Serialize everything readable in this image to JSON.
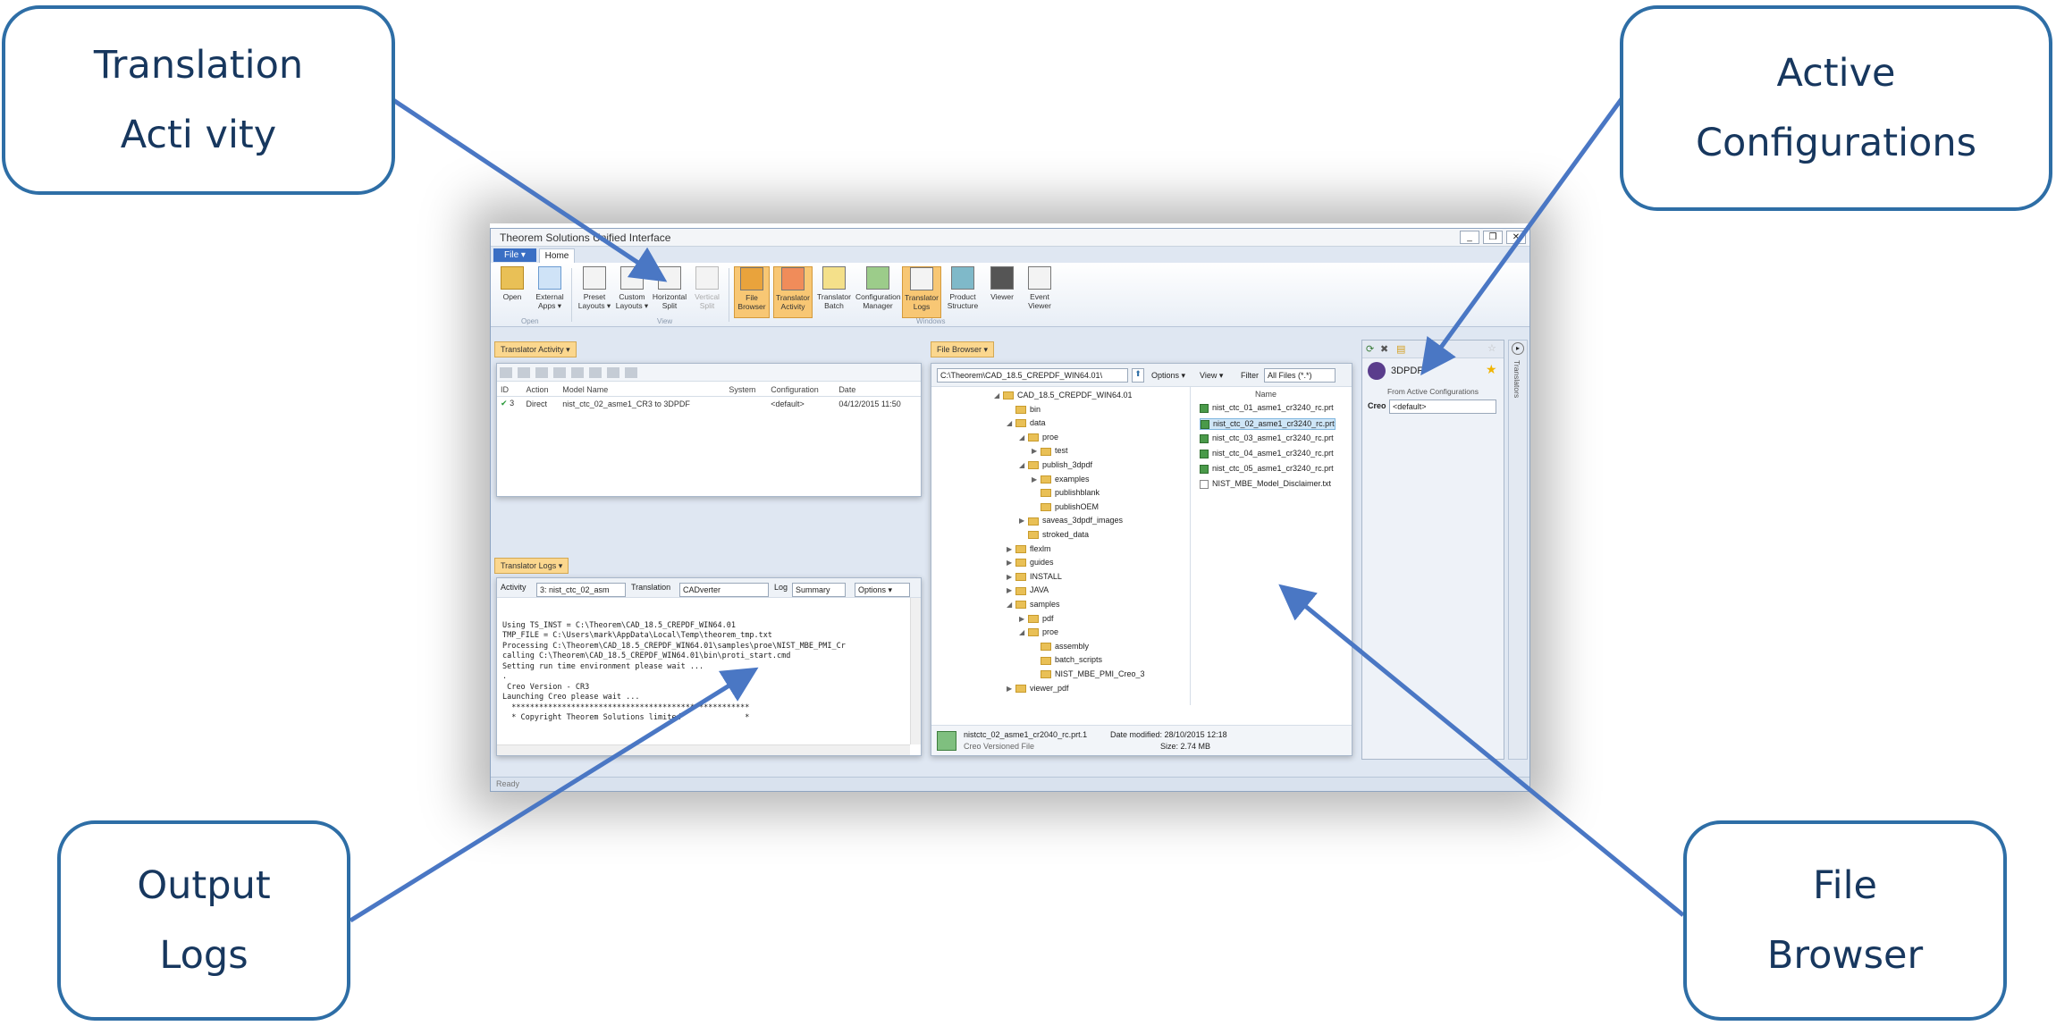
{
  "callouts": {
    "translation": [
      "Translation",
      "Acti vity"
    ],
    "active": [
      "Active",
      "Configurations"
    ],
    "output": [
      "Output",
      "Logs"
    ],
    "file_browser": [
      "File",
      "Browser"
    ]
  },
  "window": {
    "title": "Theorem Solutions Unified Interface",
    "controls": [
      "_",
      "❐",
      "✕"
    ],
    "file_tab": "File ▾",
    "home_tab": "Home"
  },
  "ribbon": {
    "buttons": [
      {
        "label": "Open",
        "icon": "folder-open-icon"
      },
      {
        "label": "External Apps ▾",
        "icon": "external-apps-icon"
      },
      {
        "label": "Preset Layouts ▾",
        "icon": "preset-layout-icon"
      },
      {
        "label": "Custom Layouts ▾",
        "icon": "custom-layout-icon"
      },
      {
        "label": "Horizontal Split",
        "icon": "horizontal-split-icon"
      },
      {
        "label": "Vertical Split",
        "icon": "vertical-split-icon"
      },
      {
        "label": "File Browser",
        "icon": "file-browser-icon"
      },
      {
        "label": "Translator Activity",
        "icon": "translator-activity-icon"
      },
      {
        "label": "Translator Batch",
        "icon": "translator-batch-icon"
      },
      {
        "label": "Configuration Manager",
        "icon": "configuration-manager-icon"
      },
      {
        "label": "Translator Logs",
        "icon": "translator-logs-icon"
      },
      {
        "label": "Product Structure",
        "icon": "product-structure-icon"
      },
      {
        "label": "Viewer",
        "icon": "viewer-icon"
      },
      {
        "label": "Event Viewer",
        "icon": "event-viewer-icon"
      }
    ],
    "groups": [
      "Open",
      "View",
      "Windows"
    ]
  },
  "translator_activity": {
    "tab": "Translator Activity ▾",
    "columns": [
      "ID",
      "Action",
      "Model Name",
      "System",
      "Configuration",
      "Date"
    ],
    "rows": [
      {
        "id": "3",
        "action": "Direct",
        "model": "nist_ctc_02_asme1_CR3 to 3DPDF",
        "system": "",
        "configuration": "<default>",
        "date": "04/12/2015 11:50"
      }
    ]
  },
  "translator_logs": {
    "tab": "Translator Logs ▾",
    "activity_label": "Activity",
    "activity_value": "3: nist_ctc_02_asm",
    "translation_label": "Translation",
    "translation_value": "CADverter",
    "log_label": "Log",
    "log_value": "Summary",
    "options_label": "Options ▾",
    "lines": [
      "Using TS_INST = C:\\Theorem\\CAD_18.5_CREPDF_WIN64.01",
      "TMP_FILE = C:\\Users\\mark\\AppData\\Local\\Temp\\theorem_tmp.txt",
      "Processing C:\\Theorem\\CAD_18.5_CREPDF_WIN64.01\\samples\\proe\\NIST_MBE_PMI_Cr",
      "calling C:\\Theorem\\CAD_18.5_CREPDF_WIN64.01\\bin\\proti_start.cmd",
      "Setting run time environment please wait ...",
      ".",
      " Creo Version - CR3",
      "Launching Creo please wait ...",
      "",
      "  ****************************************************",
      "  * Copyright Theorem Solutions limited              *"
    ]
  },
  "file_browser": {
    "tab": "File Browser ▾",
    "path": "C:\\Theorem\\CAD_18.5_CREPDF_WIN64.01\\",
    "options_label": "Options ▾",
    "view_label": "View ▾",
    "filter_label": "Filter",
    "filter_value": "All Files (*.*)",
    "name_column": "Name",
    "tree": [
      {
        "label": "CAD_18.5_CREPDF_WIN64.01",
        "depth": 0,
        "exp": "◢"
      },
      {
        "label": "bin",
        "depth": 1,
        "exp": ""
      },
      {
        "label": "data",
        "depth": 1,
        "exp": "◢"
      },
      {
        "label": "proe",
        "depth": 2,
        "exp": "◢"
      },
      {
        "label": "test",
        "depth": 3,
        "exp": "▶"
      },
      {
        "label": "publish_3dpdf",
        "depth": 2,
        "exp": "◢"
      },
      {
        "label": "examples",
        "depth": 3,
        "exp": "▶"
      },
      {
        "label": "publishblank",
        "depth": 3,
        "exp": ""
      },
      {
        "label": "publishOEM",
        "depth": 3,
        "exp": ""
      },
      {
        "label": "saveas_3dpdf_images",
        "depth": 2,
        "exp": "▶"
      },
      {
        "label": "stroked_data",
        "depth": 2,
        "exp": ""
      },
      {
        "label": "flexlm",
        "depth": 1,
        "exp": "▶"
      },
      {
        "label": "guides",
        "depth": 1,
        "exp": "▶"
      },
      {
        "label": "INSTALL",
        "depth": 1,
        "exp": "▶"
      },
      {
        "label": "JAVA",
        "depth": 1,
        "exp": "▶"
      },
      {
        "label": "samples",
        "depth": 1,
        "exp": "◢"
      },
      {
        "label": "pdf",
        "depth": 2,
        "exp": "▶"
      },
      {
        "label": "proe",
        "depth": 2,
        "exp": "◢"
      },
      {
        "label": "assembly",
        "depth": 3,
        "exp": ""
      },
      {
        "label": "batch_scripts",
        "depth": 3,
        "exp": ""
      },
      {
        "label": "NIST_MBE_PMI_Creo_3",
        "depth": 3,
        "exp": ""
      },
      {
        "label": "viewer_pdf",
        "depth": 1,
        "exp": "▶"
      }
    ],
    "files": [
      "nist_ctc_01_asme1_cr3240_rc.prt",
      "nist_ctc_02_asme1_cr3240_rc.prt",
      "nist_ctc_03_asme1_cr3240_rc.prt",
      "nist_ctc_04_asme1_cr3240_rc.prt",
      "nist_ctc_05_asme1_cr3240_rc.prt",
      "NIST_MBE_Model_Disclaimer.txt"
    ],
    "info_name": "nistctc_02_asme1_cr2040_rc.prt.1",
    "info_type": "Creo Versioned File",
    "info_modified": "Date modified: 28/10/2015 12:18",
    "info_size": "Size: 2.74 MB"
  },
  "active_config": {
    "product": "3DPDF",
    "from_label": "From Active Configurations",
    "creo_label": "Creo",
    "creo_value": "<default>",
    "side_label": "Translators"
  },
  "status": {
    "left": "Ready"
  }
}
